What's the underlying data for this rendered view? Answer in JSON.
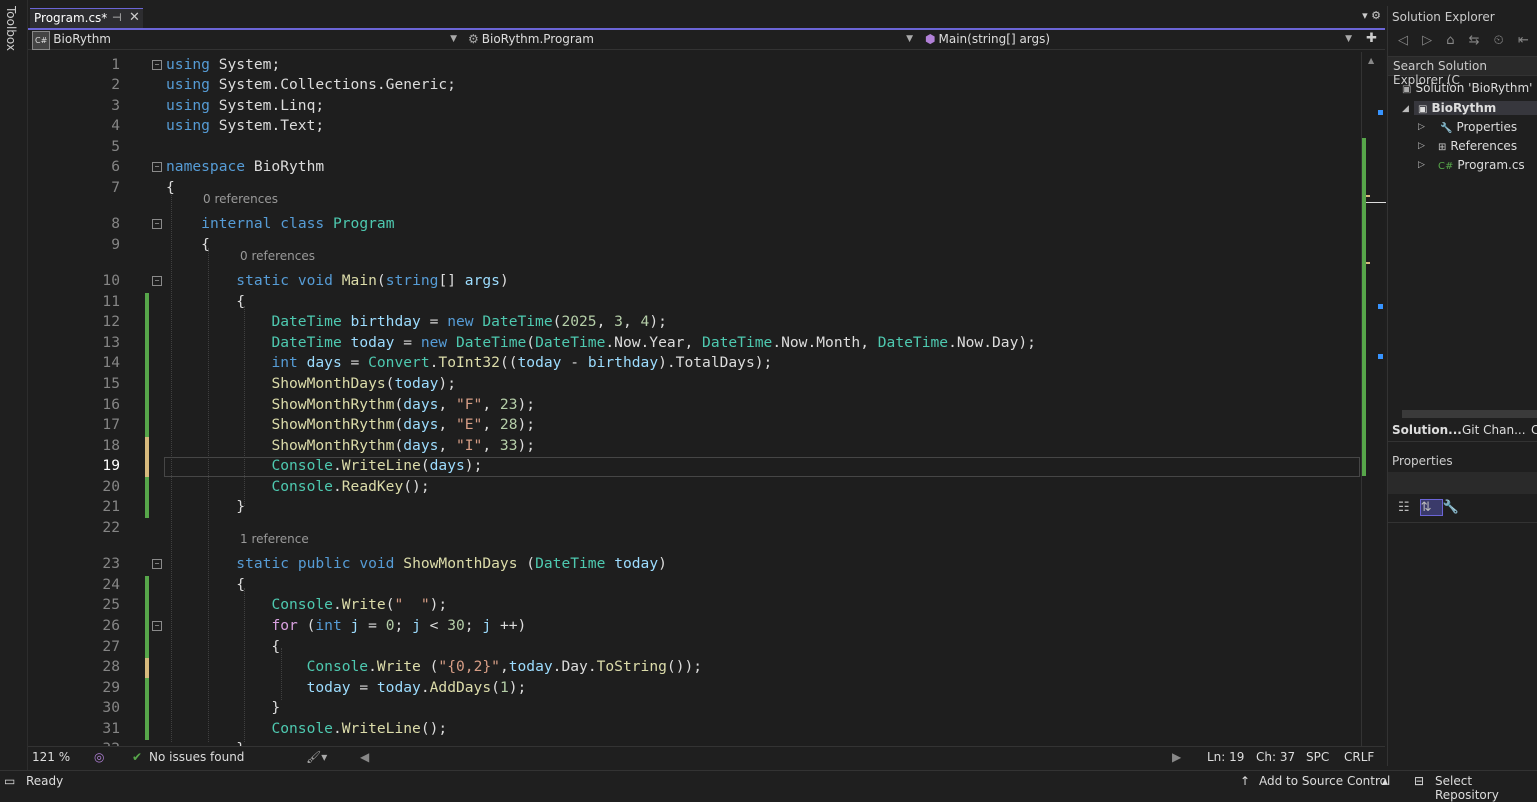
{
  "toolbox": {
    "label": "Toolbox"
  },
  "tab": {
    "title": "Program.cs*",
    "pin": "⊣",
    "close": "✕"
  },
  "tab_controls": "▾ ⚙",
  "nav": {
    "project": "BioRythm",
    "class": "BioRythm.Program",
    "member": "Main(string[] args)",
    "badge": "C#"
  },
  "code_lines": [
    {
      "n": "1",
      "html": "<span class='kw'>using</span> System;"
    },
    {
      "n": "2",
      "html": "<span class='kw'>using</span> System.Collections.Generic;"
    },
    {
      "n": "3",
      "html": "<span class='kw'>using</span> System.Linq;"
    },
    {
      "n": "4",
      "html": "<span class='kw'>using</span> System.Text;"
    },
    {
      "n": "5",
      "html": ""
    },
    {
      "n": "6",
      "html": "<span class='kw'>namespace</span> BioRythm"
    },
    {
      "n": "7",
      "html": "{"
    },
    {
      "n": "8",
      "html": "    <span class='kw'>internal</span> <span class='kw'>class</span> <span class='ty'>Program</span>"
    },
    {
      "n": "9",
      "html": "    {"
    },
    {
      "n": "10",
      "html": "        <span class='kw'>static</span> <span class='kw'>void</span> <span class='fn'>Main</span>(<span class='kw'>string</span>[] <span class='va'>args</span>)"
    },
    {
      "n": "11",
      "html": "        {"
    },
    {
      "n": "12",
      "html": "            <span class='ty'>DateTime</span> <span class='va'>birthday</span> = <span class='kw'>new</span> <span class='ty'>DateTime</span>(<span class='nu'>2025</span>, <span class='nu'>3</span>, <span class='nu'>4</span>);"
    },
    {
      "n": "13",
      "html": "            <span class='ty'>DateTime</span> <span class='va'>today</span> = <span class='kw'>new</span> <span class='ty'>DateTime</span>(<span class='ty'>DateTime</span>.Now.Year, <span class='ty'>DateTime</span>.Now.Month, <span class='ty'>DateTime</span>.Now.Day);"
    },
    {
      "n": "14",
      "html": "            <span class='kw'>int</span> <span class='va'>days</span> = <span class='ty'>Convert</span>.<span class='fn'>ToInt32</span>((<span class='va'>today</span> - <span class='va'>birthday</span>).TotalDays);"
    },
    {
      "n": "15",
      "html": "            <span class='fn'>ShowMonthDays</span>(<span class='va'>today</span>);"
    },
    {
      "n": "16",
      "html": "            <span class='fn'>ShowMonthRythm</span>(<span class='va'>days</span>, <span class='st'>\"F\"</span>, <span class='nu'>23</span>);"
    },
    {
      "n": "17",
      "html": "            <span class='fn'>ShowMonthRythm</span>(<span class='va'>days</span>, <span class='st'>\"E\"</span>, <span class='nu'>28</span>);"
    },
    {
      "n": "18",
      "html": "            <span class='fn'>ShowMonthRythm</span>(<span class='va'>days</span>, <span class='st'>\"I\"</span>, <span class='nu'>33</span>);"
    },
    {
      "n": "19",
      "html": "            <span class='ty'>Console</span>.<span class='fn'>WriteLine</span>(<span class='va'>days</span>);"
    },
    {
      "n": "20",
      "html": "            <span class='ty'>Console</span>.<span class='fn'>ReadKey</span>();"
    },
    {
      "n": "21",
      "html": "        }"
    },
    {
      "n": "22",
      "html": ""
    },
    {
      "n": "23",
      "html": "        <span class='kw'>static</span> <span class='kw'>public</span> <span class='kw'>void</span> <span class='fn'>ShowMonthDays</span> (<span class='ty'>DateTime</span> <span class='va'>today</span>)"
    },
    {
      "n": "24",
      "html": "        {"
    },
    {
      "n": "25",
      "html": "            <span class='ty'>Console</span>.<span class='fn'>Write</span>(<span class='st'>\"  \"</span>);"
    },
    {
      "n": "26",
      "html": "            <span class='ctl'>for</span> (<span class='kw'>int</span> <span class='va'>j</span> = <span class='nu'>0</span>; <span class='va'>j</span> &lt; <span class='nu'>30</span>; <span class='va'>j</span> ++)"
    },
    {
      "n": "27",
      "html": "            {"
    },
    {
      "n": "28",
      "html": "                <span class='ty'>Console</span>.<span class='fn'>Write</span> (<span class='st'>\"{0,2}\"</span>,<span class='va'>today</span>.Day.<span class='fn'>ToString</span>());"
    },
    {
      "n": "29",
      "html": "                <span class='va'>today</span> = <span class='va'>today</span>.<span class='fn'>AddDays</span>(<span class='nu'>1</span>);"
    },
    {
      "n": "30",
      "html": "            }"
    },
    {
      "n": "31",
      "html": "            <span class='ty'>Console</span>.<span class='fn'>WriteLine</span>();"
    },
    {
      "n": "32",
      "html": "        }"
    }
  ],
  "references": {
    "r8": "0 references",
    "r10": "0 references",
    "r23": "1 reference"
  },
  "editor_status": {
    "zoom": "121 %",
    "issues": "No issues found",
    "ln": "Ln: 19",
    "ch": "Ch: 37",
    "spc": "SPC",
    "crlf": "CRLF"
  },
  "solution_explorer": {
    "title": "Solution Explorer",
    "search_placeholder": "Search Solution Explorer (C",
    "solution": "Solution 'BioRythm' (",
    "project": "BioRythm",
    "items": [
      "Properties",
      "References",
      "Program.cs"
    ],
    "toolbar_icons": "◁ ▷ ⌂ ⇆ ⏲ ⇤"
  },
  "right_tabs": [
    "Solution...",
    "Git Chan...",
    "C"
  ],
  "properties": {
    "title": "Properties"
  },
  "status": {
    "ready": "Ready",
    "add_source": "Add to Source Control",
    "select_repo": "Select Repository"
  },
  "colors": {
    "accent": "#6b65d6",
    "changed": "#57a64a"
  }
}
